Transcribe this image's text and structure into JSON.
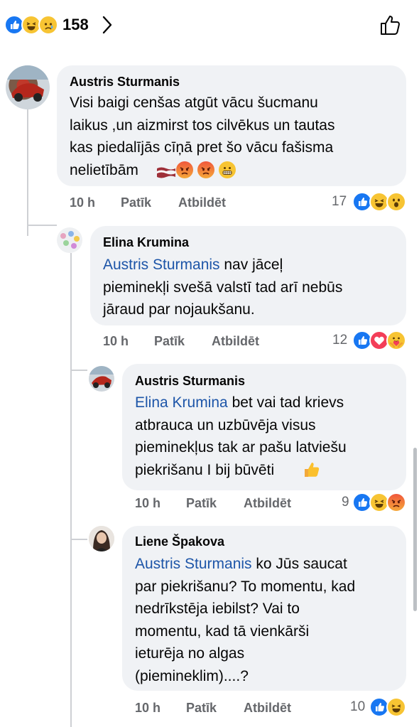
{
  "top": {
    "reaction_count": "158",
    "reactions": [
      "like",
      "haha",
      "sad"
    ]
  },
  "comments": [
    {
      "author": "Austris Sturmanis",
      "mention": "",
      "lines": [
        "Visi baigi cenšas atgūt vācu šucmanu",
        "laikus ,un aizmirst tos cilvēkus un tautas",
        "kas piedalījās cīņā pret šo vācu fašisma",
        "nelietībām"
      ],
      "trailing_emoji": [
        "latvia-flag",
        "angry",
        "angry",
        "grimace"
      ],
      "time": "10 h",
      "like_label": "Patīk",
      "reply_label": "Atbildēt",
      "reaction_count": "17",
      "reactions": [
        "like",
        "haha",
        "wow"
      ]
    },
    {
      "author": "Elina Krumina",
      "mention": "Austris Sturmanis",
      "lines": [
        " nav jāceļ",
        "pieminekļi svešā valstī tad arī nebūs",
        "jāraud par nojaukšanu."
      ],
      "time": "10 h",
      "like_label": "Patīk",
      "reply_label": "Atbildēt",
      "reaction_count": "12",
      "reactions": [
        "like",
        "love",
        "care"
      ]
    },
    {
      "author": "Austris Sturmanis",
      "mention": "Elina Krumina",
      "lines": [
        " bet vai tad krievs",
        "atbrauca un uzbūvēja visus",
        "pieminekļus tak ar pašu latviešu",
        "piekrišanu I bij būvēti"
      ],
      "trailing_emoji": [
        "thumbs-up"
      ],
      "time": "10 h",
      "like_label": "Patīk",
      "reply_label": "Atbildēt",
      "reaction_count": "9",
      "reactions": [
        "like",
        "haha",
        "angry"
      ]
    },
    {
      "author": "Liene Špakova",
      "mention": "Austris Sturmanis",
      "lines": [
        " ko Jūs saucat",
        "par piekrišanu? To momentu, kad",
        "nedrīkstēja iebilst? Vai to",
        "momentu, kad tā vienkārši",
        "ieturēja no algas",
        "(piemineklim)....?"
      ],
      "time": "10 h",
      "like_label": "Patīk",
      "reply_label": "Atbildēt",
      "reaction_count": "10",
      "reactions": [
        "like",
        "haha"
      ]
    }
  ]
}
